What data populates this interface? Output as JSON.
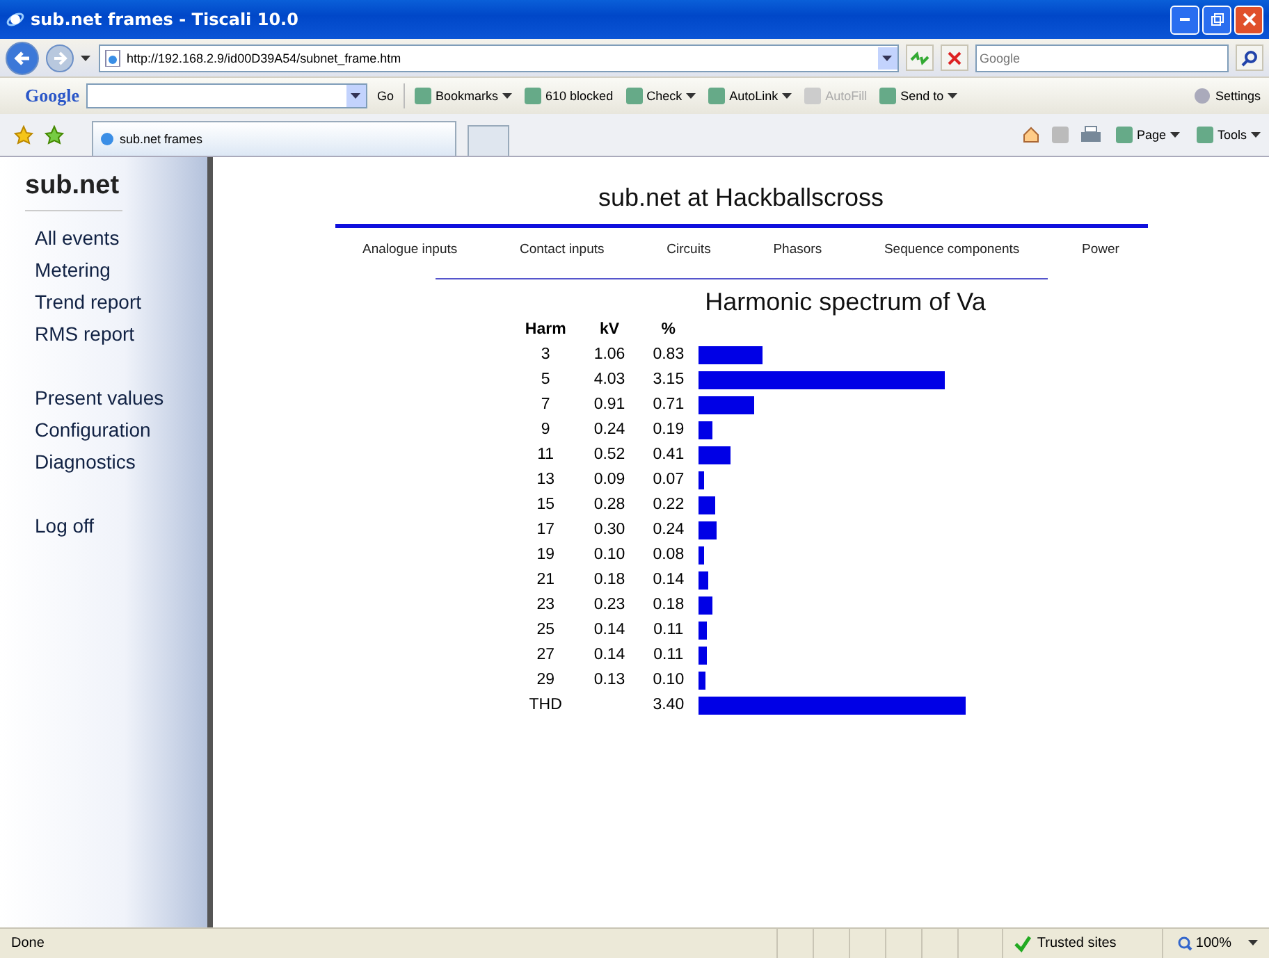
{
  "window": {
    "title": "sub.net frames - Tiscali 10.0"
  },
  "address_bar": {
    "url": "http://192.168.2.9/id00D39A54/subnet_frame.htm",
    "search_placeholder": "Google"
  },
  "google_toolbar": {
    "brand": "Google",
    "go": "Go",
    "items": [
      {
        "label": "Bookmarks",
        "disabled": false,
        "dropdown": true
      },
      {
        "label": "610 blocked",
        "disabled": false,
        "dropdown": false
      },
      {
        "label": "Check",
        "disabled": false,
        "dropdown": true
      },
      {
        "label": "AutoLink",
        "disabled": false,
        "dropdown": true
      },
      {
        "label": "AutoFill",
        "disabled": true,
        "dropdown": false
      },
      {
        "label": "Send to",
        "disabled": false,
        "dropdown": true
      }
    ],
    "settings": "Settings"
  },
  "tab": {
    "label": "sub.net frames"
  },
  "command_bar": [
    "Page",
    "Tools"
  ],
  "sidebar": {
    "brand": "sub.net",
    "groups": [
      [
        "All events",
        "Metering",
        "Trend report",
        "RMS report"
      ],
      [
        "Present values",
        "Configuration",
        "Diagnostics"
      ],
      [
        "Log off"
      ]
    ]
  },
  "page": {
    "heading": "sub.net at Hackballscross",
    "nav": [
      "Analogue inputs",
      "Contact inputs",
      "Circuits",
      "Phasors",
      "Sequence components",
      "Power"
    ],
    "spectrum_title": "Harmonic spectrum of Va",
    "columns": [
      "Harm",
      "kV",
      "%"
    ],
    "rows": [
      {
        "harm": "3",
        "kv": "1.06",
        "pct": "0.83",
        "level": 0.244
      },
      {
        "harm": "5",
        "kv": "4.03",
        "pct": "3.15",
        "level": 0.926
      },
      {
        "harm": "7",
        "kv": "0.91",
        "pct": "0.71",
        "level": 0.209
      },
      {
        "harm": "9",
        "kv": "0.24",
        "pct": "0.19",
        "level": 0.056
      },
      {
        "harm": "11",
        "kv": "0.52",
        "pct": "0.41",
        "level": 0.121
      },
      {
        "harm": "13",
        "kv": "0.09",
        "pct": "0.07",
        "level": 0.021
      },
      {
        "harm": "15",
        "kv": "0.28",
        "pct": "0.22",
        "level": 0.065
      },
      {
        "harm": "17",
        "kv": "0.30",
        "pct": "0.24",
        "level": 0.071
      },
      {
        "harm": "19",
        "kv": "0.10",
        "pct": "0.08",
        "level": 0.024
      },
      {
        "harm": "21",
        "kv": "0.18",
        "pct": "0.14",
        "level": 0.041
      },
      {
        "harm": "23",
        "kv": "0.23",
        "pct": "0.18",
        "level": 0.053
      },
      {
        "harm": "25",
        "kv": "0.14",
        "pct": "0.11",
        "level": 0.032
      },
      {
        "harm": "27",
        "kv": "0.14",
        "pct": "0.11",
        "level": 0.032
      },
      {
        "harm": "29",
        "kv": "0.13",
        "pct": "0.10",
        "level": 0.029
      },
      {
        "harm": "THD",
        "kv": "",
        "pct": "3.40",
        "level": 1
      }
    ]
  },
  "status_bar": {
    "text": "Done",
    "zone": "Trusted sites",
    "zoom": "100%"
  }
}
